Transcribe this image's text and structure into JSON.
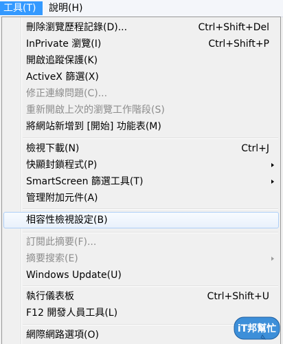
{
  "menubar": {
    "tools": "工具(T)",
    "help": "說明(H)"
  },
  "menu": {
    "items": [
      {
        "label": "刪除瀏覽歷程記錄(D)...",
        "shortcut": "Ctrl+Shift+Del"
      },
      {
        "label": "InPrivate 瀏覽(I)",
        "shortcut": "Ctrl+Shift+P"
      },
      {
        "label": "開啟追蹤保護(K)",
        "shortcut": ""
      },
      {
        "label": "ActiveX 篩選(X)",
        "shortcut": ""
      },
      {
        "label": "修正連線問題(C)...",
        "shortcut": "",
        "disabled": true
      },
      {
        "label": "重新開啟上次的瀏覽工作階段(S)",
        "shortcut": "",
        "disabled": true
      },
      {
        "label": "將網站新增到 [開始] 功能表(M)",
        "shortcut": ""
      },
      {
        "label": "檢視下載(N)",
        "shortcut": "Ctrl+J"
      },
      {
        "label": "快顯封鎖程式(P)",
        "shortcut": "",
        "submenu": true
      },
      {
        "label": "SmartScreen 篩選工具(T)",
        "shortcut": "",
        "submenu": true
      },
      {
        "label": "管理附加元件(A)",
        "shortcut": ""
      },
      {
        "label": "相容性檢視設定(B)",
        "shortcut": "",
        "highlighted": true
      },
      {
        "label": "訂閱此摘要(F)...",
        "shortcut": "",
        "disabled": true
      },
      {
        "label": "摘要搜索(E)",
        "shortcut": "",
        "disabled": true,
        "submenu": true
      },
      {
        "label": "Windows Update(U)",
        "shortcut": ""
      },
      {
        "label": "執行儀表板",
        "shortcut": "Ctrl+Shift+U"
      },
      {
        "label": "F12 開發人員工具(L)",
        "shortcut": ""
      },
      {
        "label": "網際網路選項(O)",
        "shortcut": ""
      }
    ]
  },
  "watermark": {
    "text": "iT邦幫忙",
    "colors": {
      "badge": "#3d8fd9",
      "outline": "#1f5e9e"
    }
  },
  "colors": {
    "menubar_active": "#3399ff",
    "highlight_border": "#aecff7",
    "disabled_text": "#8c8c8c"
  }
}
